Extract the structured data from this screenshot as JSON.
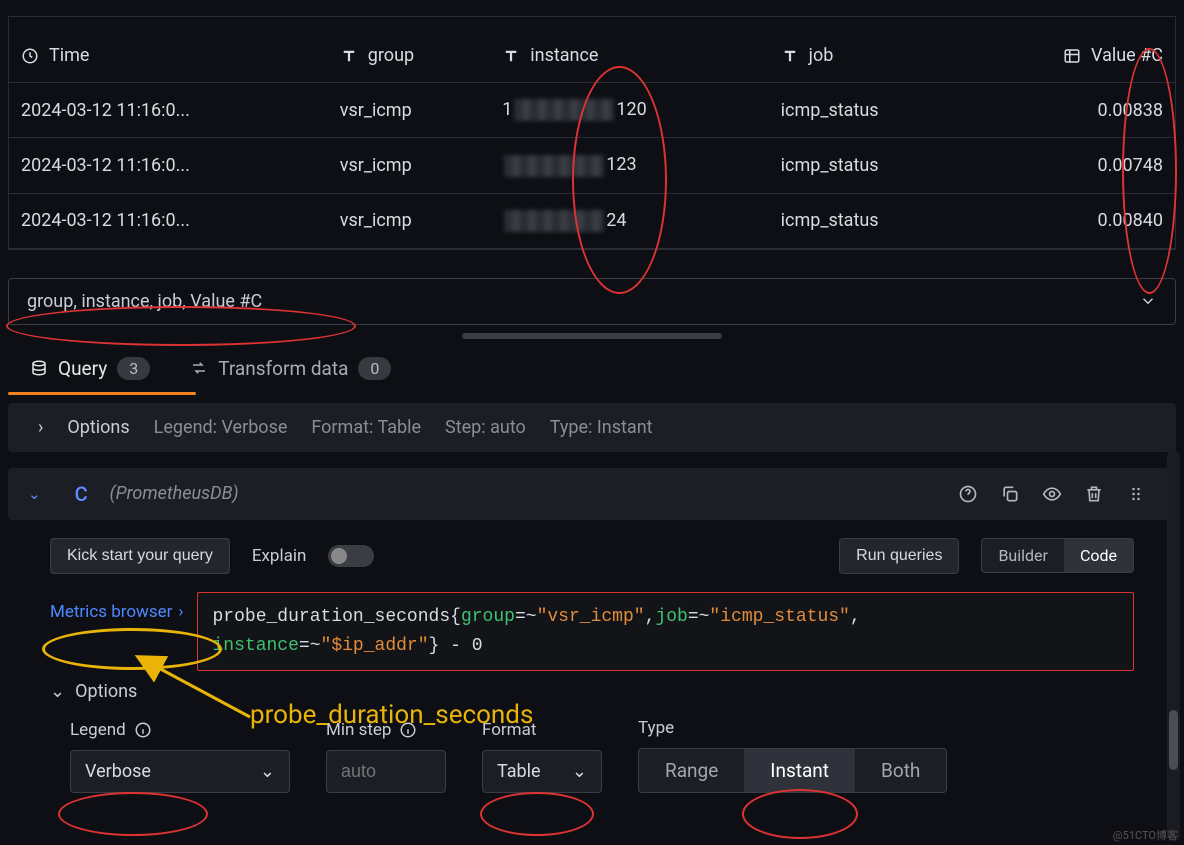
{
  "table": {
    "headers": {
      "time": "Time",
      "group": "group",
      "instance": "instance",
      "job": "job",
      "value": "Value #C"
    },
    "rows": [
      {
        "time": "2024-03-12 11:16:0...",
        "group": "vsr_icmp",
        "inst_prefix": "1",
        "inst_suffix": "120",
        "job": "icmp_status",
        "value": "0.00838"
      },
      {
        "time": "2024-03-12 11:16:0...",
        "group": "vsr_icmp",
        "inst_prefix": "",
        "inst_suffix": "123",
        "job": "icmp_status",
        "value": "0.00748"
      },
      {
        "time": "2024-03-12 11:16:0...",
        "group": "vsr_icmp",
        "inst_prefix": "",
        "inst_suffix": "24",
        "job": "icmp_status",
        "value": "0.00840"
      }
    ]
  },
  "fields_summary": "group, instance, job, Value #C",
  "tabs": {
    "query_label": "Query",
    "query_count": "3",
    "transform_label": "Transform data",
    "transform_count": "0"
  },
  "options_bar": {
    "options": "Options",
    "legend": "Legend: Verbose",
    "format": "Format: Table",
    "step": "Step: auto",
    "type": "Type: Instant"
  },
  "query": {
    "letter": "C",
    "datasource": "(PrometheusDB)"
  },
  "toolbar": {
    "kick": "Kick start your query",
    "explain": "Explain",
    "run": "Run queries",
    "builder": "Builder",
    "code": "Code"
  },
  "metrics_browser": "Metrics browser",
  "promql": {
    "fn": "probe_duration_seconds",
    "lbl_group": "group",
    "str_group": "\"vsr_icmp\"",
    "lbl_job": "job",
    "str_job": "\"icmp_status\"",
    "lbl_instance": "instance",
    "str_instance": "\"$ip_addr\"",
    "tail": "} - 0",
    "op": "=~"
  },
  "annotation_text": "probe_duration_seconds",
  "options2": "Options",
  "form": {
    "legend_label": "Legend",
    "legend_value": "Verbose",
    "minstep_label": "Min step",
    "minstep_placeholder": "auto",
    "format_label": "Format",
    "format_value": "Table",
    "type_label": "Type",
    "type_range": "Range",
    "type_instant": "Instant",
    "type_both": "Both"
  },
  "watermark": "@51CTO博客"
}
